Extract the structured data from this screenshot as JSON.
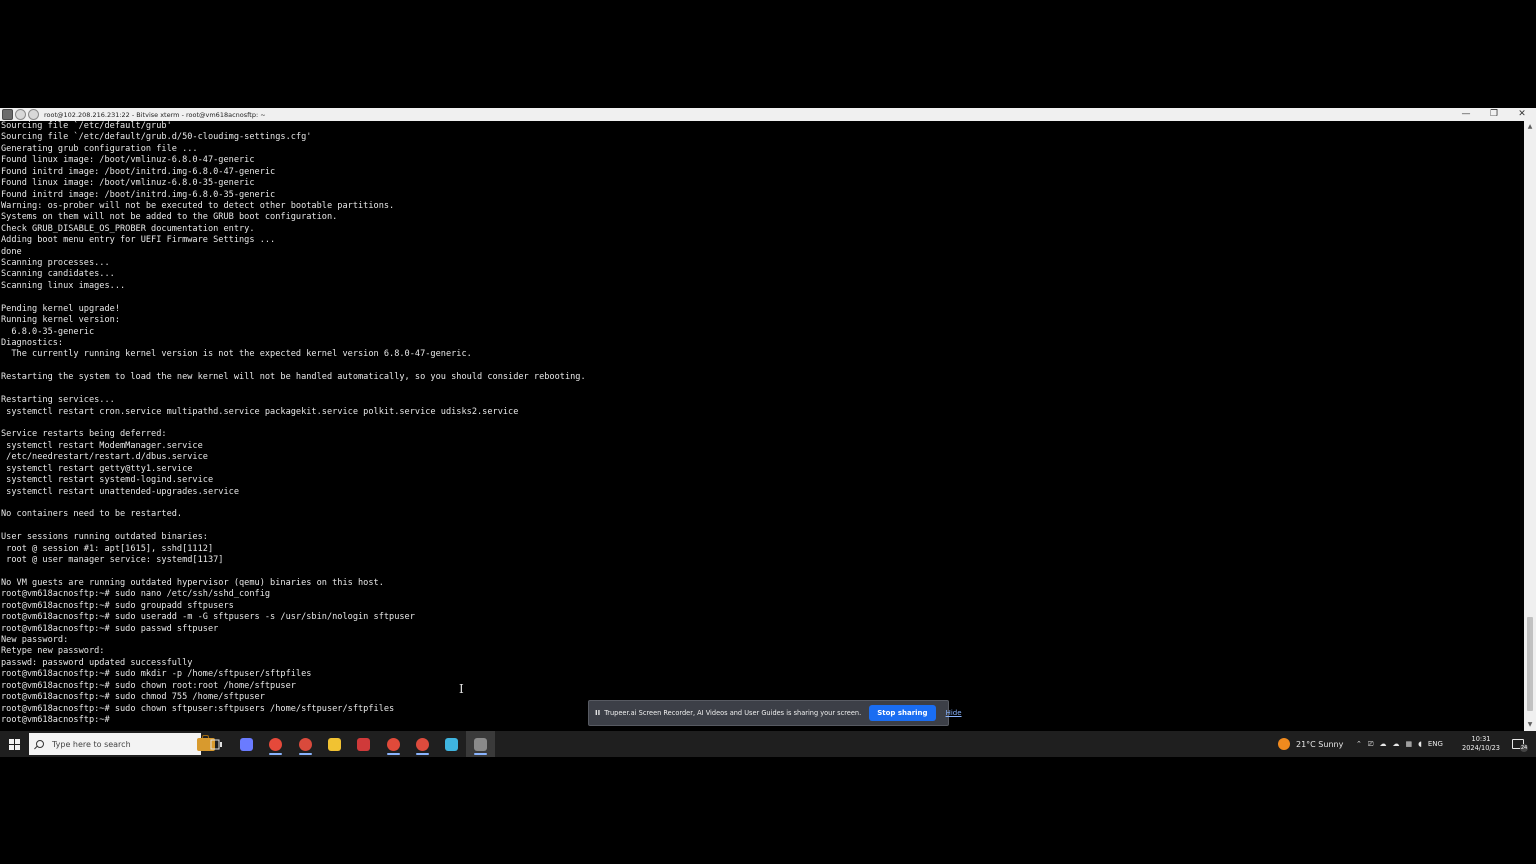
{
  "window": {
    "title": "root@102.208.216.231:22 - Bitvise xterm - root@vm618acnosftp: ~",
    "controls": {
      "minimize": "—",
      "maximize": "❐",
      "close": "✕"
    }
  },
  "terminal": {
    "lines": [
      "Sourcing file `/etc/default/grub'",
      "Sourcing file `/etc/default/grub.d/50-cloudimg-settings.cfg'",
      "Generating grub configuration file ...",
      "Found linux image: /boot/vmlinuz-6.8.0-47-generic",
      "Found initrd image: /boot/initrd.img-6.8.0-47-generic",
      "Found linux image: /boot/vmlinuz-6.8.0-35-generic",
      "Found initrd image: /boot/initrd.img-6.8.0-35-generic",
      "Warning: os-prober will not be executed to detect other bootable partitions.",
      "Systems on them will not be added to the GRUB boot configuration.",
      "Check GRUB_DISABLE_OS_PROBER documentation entry.",
      "Adding boot menu entry for UEFI Firmware Settings ...",
      "done",
      "Scanning processes...",
      "Scanning candidates...",
      "Scanning linux images...",
      "",
      "Pending kernel upgrade!",
      "Running kernel version:",
      "  6.8.0-35-generic",
      "Diagnostics:",
      "  The currently running kernel version is not the expected kernel version 6.8.0-47-generic.",
      "",
      "Restarting the system to load the new kernel will not be handled automatically, so you should consider rebooting.",
      "",
      "Restarting services...",
      " systemctl restart cron.service multipathd.service packagekit.service polkit.service udisks2.service",
      "",
      "Service restarts being deferred:",
      " systemctl restart ModemManager.service",
      " /etc/needrestart/restart.d/dbus.service",
      " systemctl restart getty@tty1.service",
      " systemctl restart systemd-logind.service",
      " systemctl restart unattended-upgrades.service",
      "",
      "No containers need to be restarted.",
      "",
      "User sessions running outdated binaries:",
      " root @ session #1: apt[1615], sshd[1112]",
      " root @ user manager service: systemd[1137]",
      "",
      "No VM guests are running outdated hypervisor (qemu) binaries on this host.",
      "root@vm618acnosftp:~# sudo nano /etc/ssh/sshd_config",
      "root@vm618acnosftp:~# sudo groupadd sftpusers",
      "root@vm618acnosftp:~# sudo useradd -m -G sftpusers -s /usr/sbin/nologin sftpuser",
      "root@vm618acnosftp:~# sudo passwd sftpuser",
      "New password:",
      "Retype new password:",
      "passwd: password updated successfully",
      "root@vm618acnosftp:~# sudo mkdir -p /home/sftpuser/sftpfiles",
      "root@vm618acnosftp:~# sudo chown root:root /home/sftpuser",
      "root@vm618acnosftp:~# sudo chmod 755 /home/sftpuser",
      "root@vm618acnosftp:~# sudo chown sftpuser:sftpusers /home/sftpuser/sftpfiles",
      "root@vm618acnosftp:~# "
    ]
  },
  "share_bar": {
    "pause_icon": "II",
    "message": "Trupeer.ai Screen Recorder, AI Videos and User Guides is sharing your screen.",
    "stop_label": "Stop sharing",
    "hide_label": "Hide"
  },
  "taskbar": {
    "search_placeholder": "Type here to search",
    "weather": "21°C  Sunny",
    "language": "ENG",
    "time": "10:31",
    "date": "2024/10/23",
    "notification_count": "24",
    "apps": [
      {
        "name": "copilot-icon",
        "color": "#6a7bff"
      },
      {
        "name": "chrome-icon-1",
        "color": "#e5493a"
      },
      {
        "name": "chrome-icon-2",
        "color": "#d94a3c"
      },
      {
        "name": "file-explorer-icon",
        "color": "#f1c232"
      },
      {
        "name": "app-red-icon",
        "color": "#d03a3a"
      },
      {
        "name": "chrome-icon-3",
        "color": "#e04a3a"
      },
      {
        "name": "chrome-icon-4",
        "color": "#dc4b3d"
      },
      {
        "name": "sync-app-icon",
        "color": "#3fb5e0"
      },
      {
        "name": "bitvise-icon",
        "color": "#8a8a8a"
      }
    ]
  }
}
